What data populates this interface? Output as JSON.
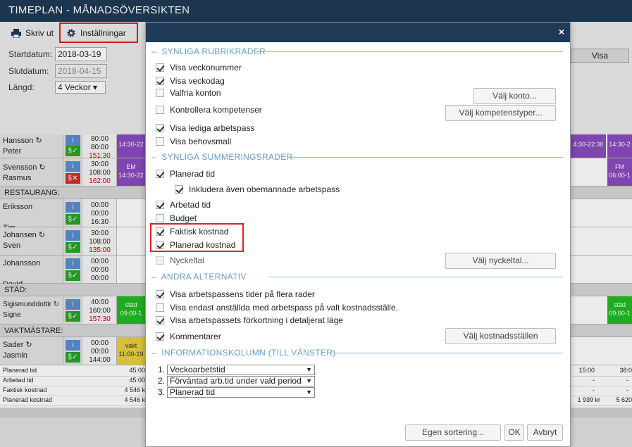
{
  "app": {
    "title": "TIMEPLAN - MÅNADSÖVERSIKTEN"
  },
  "toolbar": {
    "print_label": "Skriv ut",
    "settings_label": "Inställningar"
  },
  "form": {
    "start_label": "Startdatum:",
    "start_value": "2018-03-19",
    "end_label": "Slutdatum:",
    "end_value": "2018-04-15",
    "length_label": "Längd:",
    "length_value": "4 Veckor",
    "visa_label": "Visa"
  },
  "grid": {
    "rows": [
      {
        "last": "Hansson",
        "first": "Peter",
        "h1": "80:00",
        "h2": "151:30",
        "h0": "80:00"
      },
      {
        "last": "Svensson",
        "first": "Rasmus",
        "h0": "30:00",
        "h1": "108:00",
        "h2": "162:00"
      },
      {
        "last": "Eriksson",
        "first": "Tim",
        "h0": "00:00",
        "h1": "00:00",
        "h2": "16:30"
      },
      {
        "last": "Johansen",
        "first": "Sven",
        "h0": "30:00",
        "h1": "108:00",
        "h2": "135:00"
      },
      {
        "last": "Johansson",
        "first": "David",
        "h0": "00:00",
        "h1": "00:00",
        "h2": "00:00"
      },
      {
        "last": "Sigismunddottir",
        "first": "Signe",
        "h0": "40:00",
        "h1": "160:00",
        "h2": "157:30"
      },
      {
        "last": "Sader",
        "first": "Jasmin",
        "h0": "00:00",
        "h1": "00:00",
        "h2": "144:00"
      }
    ],
    "sections": {
      "restaurang": "RESTAURANG:",
      "stad": "STÄD:",
      "vaktmastare": "VAKTMÄSTARE:"
    },
    "cells": {
      "p1": "14:30-22",
      "p1r": "4:30-22:30",
      "p1r2": "14:30-2",
      "em_left": "EM",
      "em_left_time": "14:30-22",
      "fm_right": "FM",
      "fm_right_time": "06:00-1",
      "stad_left": "städ",
      "stad_left_time": "09:00-1",
      "stad_right": "städ",
      "stad_right_time": "09:00-1",
      "vakt": "vakt",
      "vakt_time": "11:00-19"
    },
    "sums": [
      {
        "label": "Planerad tid",
        "v1": "45:00",
        "v2": "15:00",
        "v3": "38:0"
      },
      {
        "label": "Arbetad tid",
        "v1": "45:00",
        "v2": "-",
        "v3": "-"
      },
      {
        "label": "Faktisk kostnad",
        "v1": "4 546 k",
        "v2": "-",
        "v3": "-"
      },
      {
        "label": "Planerad kostnad",
        "v1": "4 546 k",
        "v2": "1 939 kr",
        "v3": "5 620"
      }
    ]
  },
  "dialog": {
    "close": "×",
    "sec1": "SYNLIGA RUBRIKRADER",
    "sec2": "SYNLIGA SUMMERINGSRADER",
    "sec3": "ANDRA ALTERNATIV",
    "sec4": "INFORMATIONSKOLUMN (TILL VÄNSTER)",
    "opts": {
      "veckonummer": "Visa veckonummer",
      "veckodag": "Visa veckodag",
      "valfria": "Valfria konton",
      "kompetenser": "Kontrollera kompetenser",
      "lediga": "Visa lediga arbetspass",
      "behovsmall": "Visa behovsmall",
      "planerad_tid": "Planerad tid",
      "inkludera": "Inkludera även obemannade arbetspass",
      "arbetad": "Arbetad tid",
      "budget": "Budget",
      "faktisk": "Faktisk kostnad",
      "planerad_kostnad": "Planerad kostnad",
      "nyckeltal": "Nyckeltal",
      "flera_rader": "Visa arbetspassens tider på flera rader",
      "endast": "Visa endast anställda med arbetspass på valt kostnadsställe.",
      "forkortning": "Visa arbetspassets förkortning i detaljerat läge",
      "kommentarer": "Kommentarer"
    },
    "btns": {
      "konto": "Välj konto...",
      "kompetens": "Välj kompetenstyper...",
      "nyckeltal": "Välj nyckeltal...",
      "kostnad": "Välj kostnadsställen",
      "sortering": "Egen sortering...",
      "ok": "OK",
      "avbryt": "Avbryt"
    },
    "info": [
      {
        "n": "1.",
        "v": "Veckoarbetstid"
      },
      {
        "n": "2.",
        "v": "Förväntad arb.tid under vald period"
      },
      {
        "n": "3.",
        "v": "Planerad tid"
      }
    ]
  },
  "colors": {
    "titlebar": "#1f3b57",
    "section": "#6a9ec4",
    "highlight": "#e02020",
    "purple": "#8a4bbf",
    "green": "#22bb22"
  }
}
